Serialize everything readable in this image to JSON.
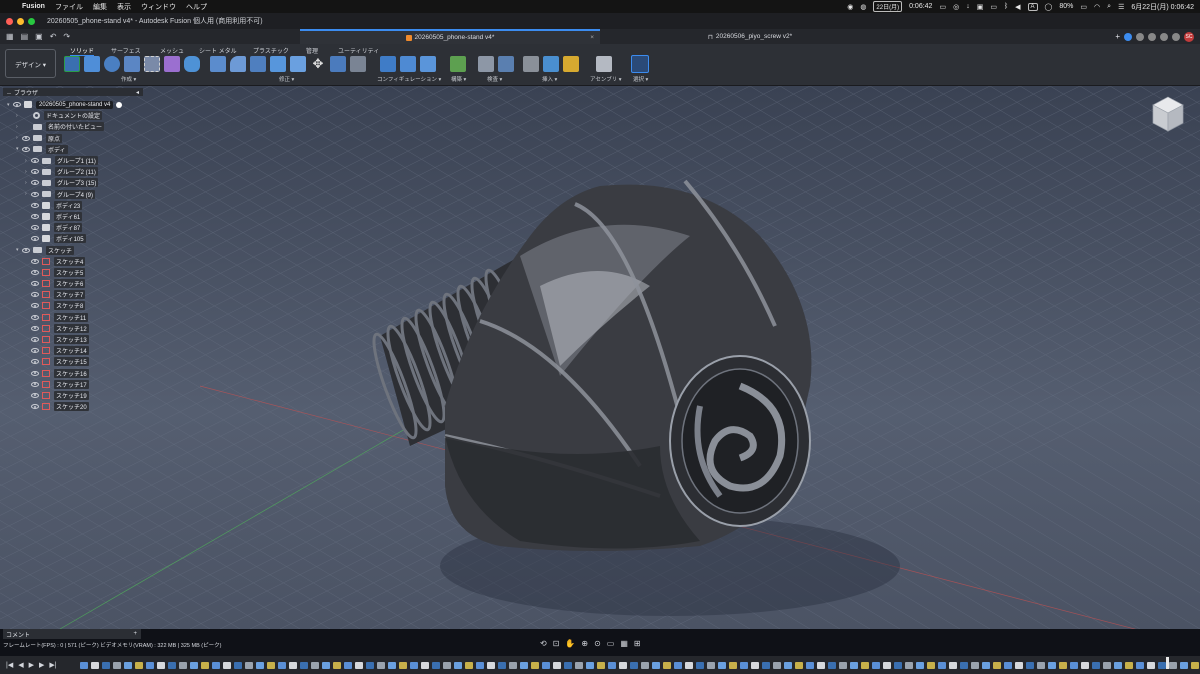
{
  "menubar": {
    "app": "Fusion",
    "items": [
      "ファイル",
      "編集",
      "表示",
      "ウィンドウ",
      "ヘルプ"
    ],
    "date_chip": "22日(月)",
    "time_left": "0:06:42",
    "input_method": "A",
    "battery": "80%",
    "datetime": "6月22日(月) 0:06:42",
    "user_badge": "SC"
  },
  "window": {
    "title": "20260505_phone-stand v4* - Autodesk Fusion 個人用 (商用利用不可)"
  },
  "doc_tabs": [
    {
      "label": "20260505_phone-stand v4*",
      "active": true
    },
    {
      "label": "20260506_piyo_screw v2*",
      "active": false
    }
  ],
  "workspace": {
    "label": "デザイン ▾"
  },
  "ribbon": {
    "tabs": [
      "ソリッド",
      "サーフェス",
      "メッシュ",
      "シート メタル",
      "プラスチック",
      "管理",
      "ユーティリティ"
    ],
    "active_tab": "ソリッド",
    "groups": [
      "作成 ▾",
      "修正 ▾",
      "コンフィギュレーション ▾",
      "構築 ▾",
      "検査 ▾",
      "挿入 ▾",
      "アセンブリ ▾",
      "選択 ▾"
    ]
  },
  "browser": {
    "title": "ブラウザ",
    "root": "20260505_phone-stand v4",
    "items": [
      {
        "label": "ドキュメントの設定",
        "kind": "gear",
        "indent": 1
      },
      {
        "label": "名前の付いたビュー",
        "kind": "folder",
        "indent": 1
      },
      {
        "label": "原点",
        "kind": "folder-eye",
        "indent": 1
      },
      {
        "label": "ボディ",
        "kind": "folder-eye",
        "indent": 1,
        "open": true
      },
      {
        "label": "グループ1 (11)",
        "kind": "folder-eye",
        "indent": 2
      },
      {
        "label": "グループ2 (11)",
        "kind": "folder-eye",
        "indent": 2
      },
      {
        "label": "グループ3 (15)",
        "kind": "folder-eye",
        "indent": 2
      },
      {
        "label": "グループ4 (9)",
        "kind": "folder-eye",
        "indent": 2
      },
      {
        "label": "ボディ23",
        "kind": "body",
        "indent": 2
      },
      {
        "label": "ボディ61",
        "kind": "body",
        "indent": 2
      },
      {
        "label": "ボディ87",
        "kind": "body",
        "indent": 2
      },
      {
        "label": "ボディ105",
        "kind": "body",
        "indent": 2
      },
      {
        "label": "スケッチ",
        "kind": "folder-eye",
        "indent": 1,
        "open": true
      },
      {
        "label": "スケッチ4",
        "kind": "sketch",
        "indent": 2
      },
      {
        "label": "スケッチ5",
        "kind": "sketch",
        "indent": 2
      },
      {
        "label": "スケッチ6",
        "kind": "sketch",
        "indent": 2
      },
      {
        "label": "スケッチ7",
        "kind": "sketch",
        "indent": 2
      },
      {
        "label": "スケッチ8",
        "kind": "sketch",
        "indent": 2
      },
      {
        "label": "スケッチ11",
        "kind": "sketch",
        "indent": 2
      },
      {
        "label": "スケッチ12",
        "kind": "sketch",
        "indent": 2
      },
      {
        "label": "スケッチ13",
        "kind": "sketch",
        "indent": 2
      },
      {
        "label": "スケッチ14",
        "kind": "sketch",
        "indent": 2
      },
      {
        "label": "スケッチ15",
        "kind": "sketch",
        "indent": 2
      },
      {
        "label": "スケッチ16",
        "kind": "sketch",
        "indent": 2
      },
      {
        "label": "スケッチ17",
        "kind": "sketch",
        "indent": 2
      },
      {
        "label": "スケッチ19",
        "kind": "sketch",
        "indent": 2
      },
      {
        "label": "スケッチ20",
        "kind": "sketch",
        "indent": 2
      }
    ]
  },
  "comments": {
    "label": "コメント"
  },
  "status": {
    "fps_text": "フレームレート(FPS) : 0 | 571 (ピーク) ビデオメモリ(VRAM) : 322 MB | 325 MB (ピーク)"
  },
  "colors": {
    "accent": "#3c8cf0",
    "viewport_top": "#3a4253",
    "viewport_bottom": "#4b5364",
    "grid_line": "#6b7486"
  }
}
